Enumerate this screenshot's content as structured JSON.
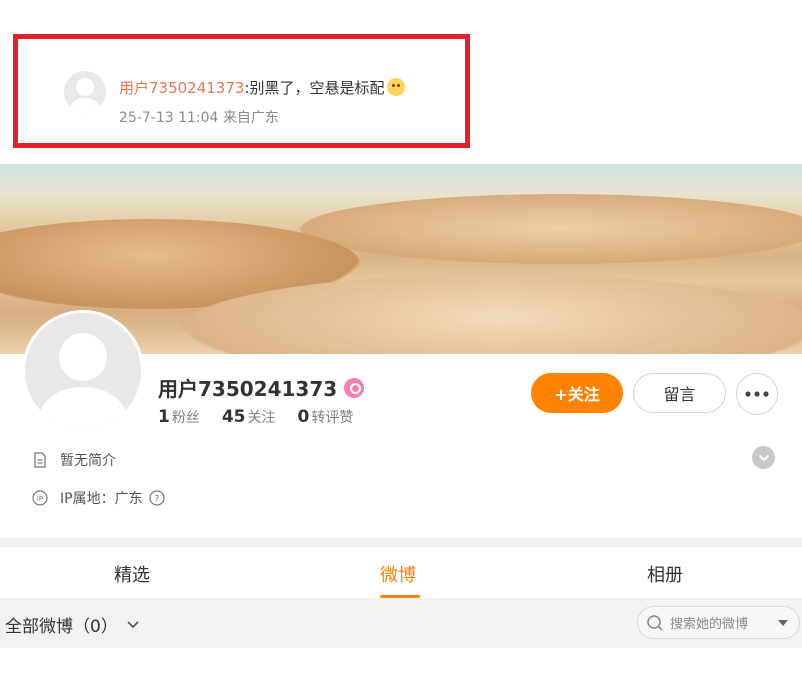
{
  "comment": {
    "username": "用户7350241373",
    "text": ":别黑了，空悬是标配",
    "emoji": "doge-emoji",
    "meta": "25-7-13 11:04 来自广东"
  },
  "profile": {
    "name": "用户7350241373",
    "stats": [
      {
        "num": "1",
        "label": "粉丝"
      },
      {
        "num": "45",
        "label": "关注"
      },
      {
        "num": "0",
        "label": "转评赞"
      }
    ],
    "follow_label": "+关注",
    "message_label": "留言",
    "bio": "暂无简介",
    "ip": "IP属地：广东"
  },
  "tabs": [
    "精选",
    "微博",
    "相册"
  ],
  "active_tab": "微博",
  "filter": {
    "label": "全部微博（0）",
    "search_placeholder": "搜索她的微博"
  },
  "colors": {
    "highlight_border": "#e3202c",
    "accent": "#ff8200",
    "username": "#eb7350"
  }
}
